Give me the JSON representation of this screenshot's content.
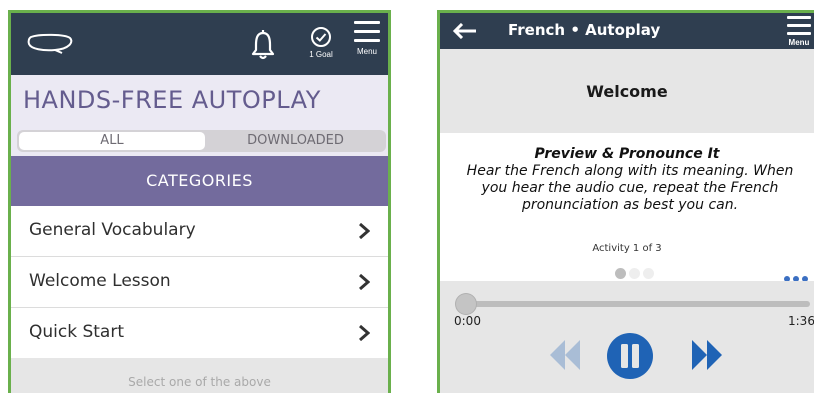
{
  "left": {
    "header": {
      "goal_label": "1 Goal",
      "menu_label": "Menu",
      "icons": [
        "logo-icon",
        "bell-icon",
        "check-circle-icon",
        "hamburger-menu-icon"
      ]
    },
    "title": "HANDS-FREE AUTOPLAY",
    "filter_tabs": [
      {
        "label": "ALL",
        "selected": true
      },
      {
        "label": "DOWNLOADED",
        "selected": false
      }
    ],
    "categories_label": "CATEGORIES",
    "items": [
      {
        "label": "General Vocabulary"
      },
      {
        "label": "Welcome Lesson"
      },
      {
        "label": "Quick Start"
      }
    ],
    "footer_hint": "Select one of the above"
  },
  "right": {
    "header": {
      "title": "French • Autoplay",
      "menu_label": "Menu",
      "icons": [
        "back-arrow-icon",
        "hamburger-menu-icon"
      ]
    },
    "lesson_title": "Welcome",
    "activity": {
      "heading": "Preview & Pronounce It",
      "description": "Hear the French along with its meaning. When you hear the audio cue, repeat the French pronunciation as best you can.",
      "counter": "Activity 1 of 3",
      "current": 1,
      "total": 3
    },
    "player": {
      "elapsed": "0:00",
      "duration": "1:36",
      "progress": 0.0,
      "state": "playing",
      "icons": [
        "rewind-icon",
        "pause-icon",
        "fast-forward-icon"
      ]
    }
  },
  "colors": {
    "header_bg": "#2f3e50",
    "accent_purple": "#736b9d",
    "title_purple": "#645c8e",
    "player_blue": "#1f63b5",
    "player_blue_light": "#a9bdd6",
    "frame_green": "#6ab04c"
  }
}
